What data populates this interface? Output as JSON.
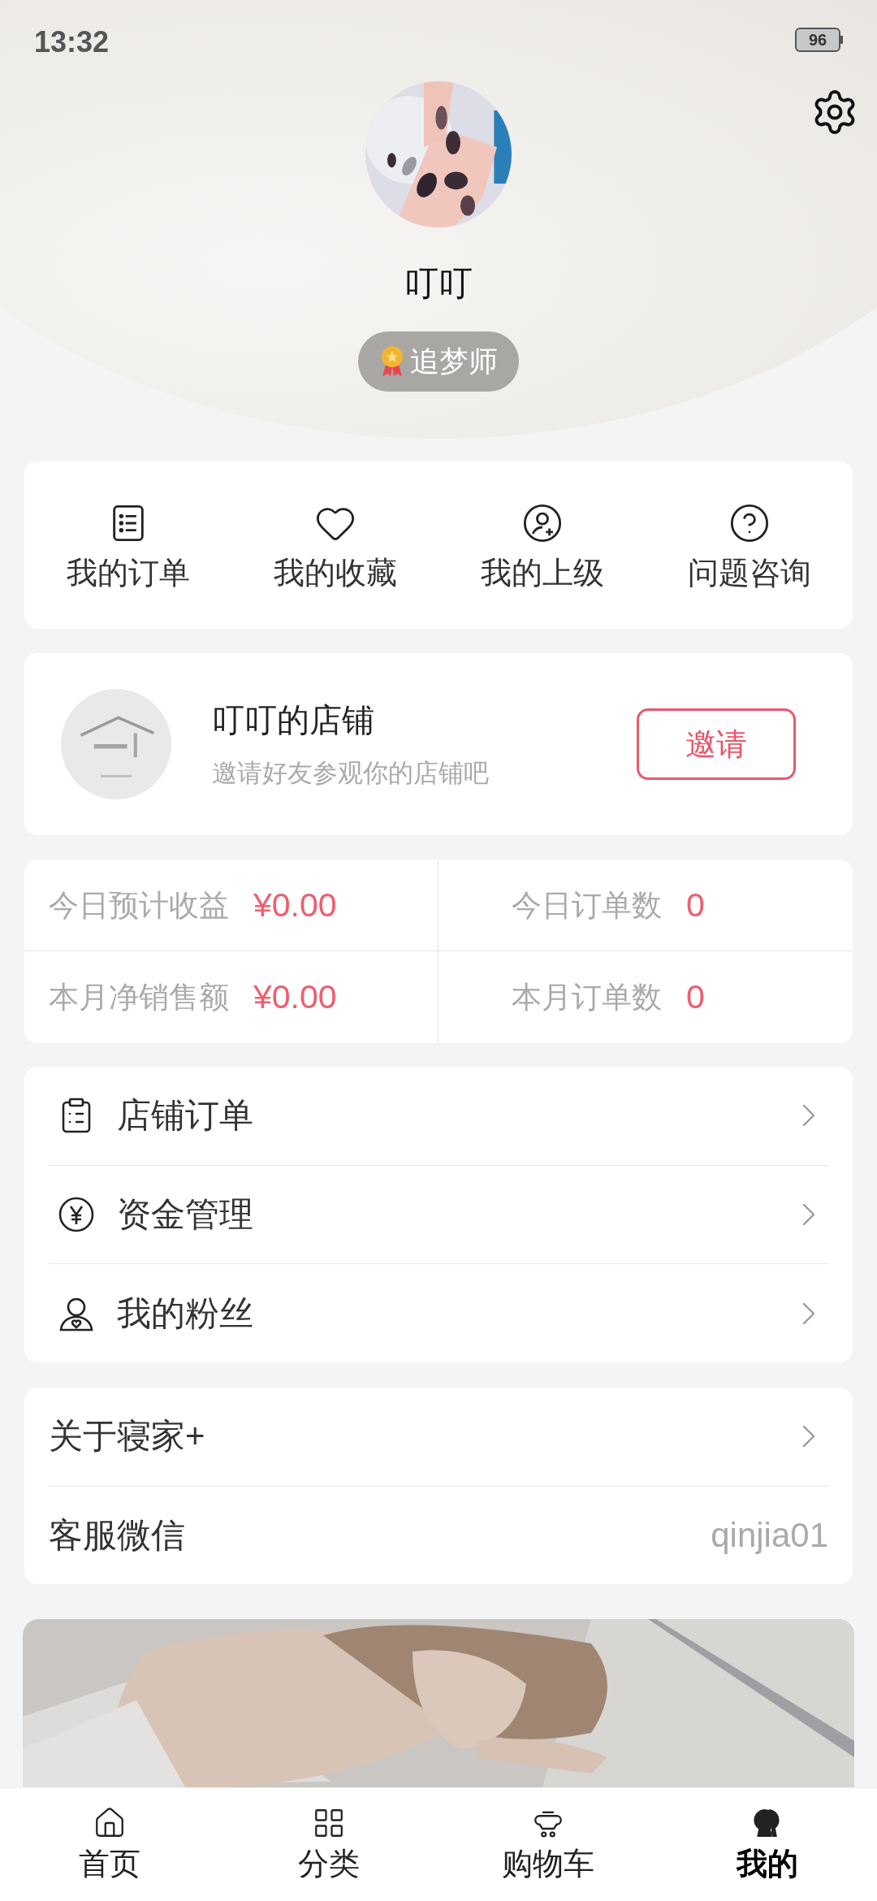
{
  "status_bar": {
    "time": "13:32",
    "battery": "96"
  },
  "profile": {
    "name": "叮叮",
    "badge": "追梦师"
  },
  "shortcuts": [
    {
      "label": "我的订单"
    },
    {
      "label": "我的收藏"
    },
    {
      "label": "我的上级"
    },
    {
      "label": "问题咨询"
    }
  ],
  "shop": {
    "title": "叮叮的店铺",
    "subtitle": "邀请好友参观你的店铺吧",
    "button": "邀请"
  },
  "stats": [
    {
      "label": "今日预计收益",
      "value": "¥0.00"
    },
    {
      "label": "今日订单数",
      "value": "0"
    },
    {
      "label": "本月净销售额",
      "value": "¥0.00"
    },
    {
      "label": "本月订单数",
      "value": "0"
    }
  ],
  "menu": [
    {
      "label": "店铺订单"
    },
    {
      "label": "资金管理"
    },
    {
      "label": "我的粉丝"
    }
  ],
  "info": [
    {
      "kind": "link",
      "label": "关于寝家+"
    },
    {
      "kind": "value",
      "label": "客服微信",
      "value": "qinjia01"
    }
  ],
  "tabs": [
    {
      "label": "首页",
      "selected": false
    },
    {
      "label": "分类",
      "selected": false
    },
    {
      "label": "购物车",
      "selected": false
    },
    {
      "label": "我的",
      "selected": true
    }
  ]
}
